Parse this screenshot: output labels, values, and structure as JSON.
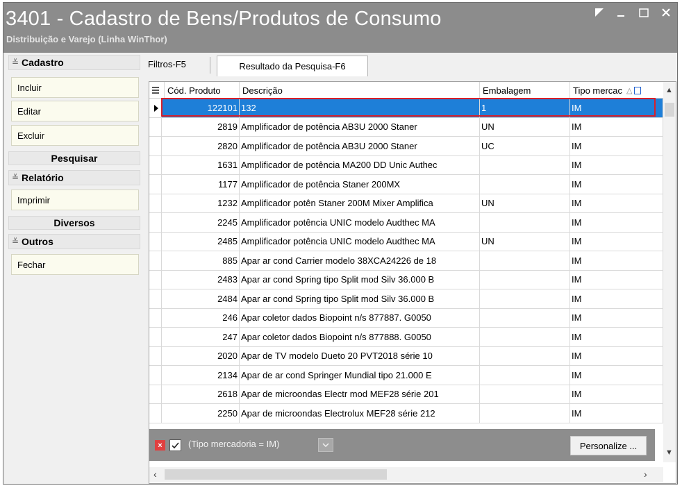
{
  "window": {
    "title": "3401 - Cadastro de Bens/Produtos de Consumo",
    "subtitle": "Distribuição e Varejo (Linha WinThor)"
  },
  "sidebar": {
    "sections": {
      "cadastro": "Cadastro",
      "pesquisar": "Pesquisar",
      "relatorio": "Relatório",
      "diversos": "Diversos",
      "outros": "Outros"
    },
    "buttons": {
      "incluir": "Incluir",
      "editar": "Editar",
      "excluir": "Excluir",
      "imprimir": "Imprimir",
      "fechar": "Fechar"
    }
  },
  "tabs": {
    "filtros": "Filtros-F5",
    "resultado": "Resultado da Pesquisa-F6"
  },
  "grid": {
    "columns": {
      "cod": "Cód. Produto",
      "desc": "Descrição",
      "emb": "Embalagem",
      "tipo": "Tipo mercac"
    },
    "rows": [
      {
        "cod": "122101",
        "desc": "132",
        "emb": "1",
        "tipo": "IM"
      },
      {
        "cod": "2819",
        "desc": "Amplificador de potência AB3U 2000 Staner",
        "emb": "UN",
        "tipo": "IM"
      },
      {
        "cod": "2820",
        "desc": "Amplificador de potência AB3U 2000 Staner",
        "emb": "UC",
        "tipo": "IM"
      },
      {
        "cod": "1631",
        "desc": "Amplificador de potência MA200 DD Unic Authec",
        "emb": "",
        "tipo": "IM"
      },
      {
        "cod": "1177",
        "desc": "Amplificador de potência Staner 200MX",
        "emb": "",
        "tipo": "IM"
      },
      {
        "cod": "1232",
        "desc": "Amplificador potên Staner 200M Mixer Amplifica",
        "emb": "UN",
        "tipo": "IM"
      },
      {
        "cod": "2245",
        "desc": "Amplificador potência UNIC modelo Audthec MA",
        "emb": "",
        "tipo": "IM"
      },
      {
        "cod": "2485",
        "desc": "Amplificador potência UNIC modelo Audthec MA",
        "emb": "UN",
        "tipo": "IM"
      },
      {
        "cod": "885",
        "desc": "Apar ar cond Carrier modelo 38XCA24226 de 18",
        "emb": "",
        "tipo": "IM"
      },
      {
        "cod": "2483",
        "desc": "Apar ar cond Spring tipo Split mod Silv 36.000 B",
        "emb": "",
        "tipo": "IM"
      },
      {
        "cod": "2484",
        "desc": "Apar ar cond Spring tipo Split mod Silv 36.000 B",
        "emb": "",
        "tipo": "IM"
      },
      {
        "cod": "246",
        "desc": "Apar coletor dados Biopoint n/s 877887. G0050",
        "emb": "",
        "tipo": "IM"
      },
      {
        "cod": "247",
        "desc": "Apar coletor dados Biopoint n/s 877888. G0050",
        "emb": "",
        "tipo": "IM"
      },
      {
        "cod": "2020",
        "desc": "Apar de TV  modelo Dueto 20 PVT2018 série 10",
        "emb": "",
        "tipo": "IM"
      },
      {
        "cod": "2134",
        "desc": "Apar de ar cond Springer Mundial tipo  21.000 E",
        "emb": "",
        "tipo": "IM"
      },
      {
        "cod": "2618",
        "desc": "Apar de microondas Electr mod MEF28 série 201",
        "emb": "",
        "tipo": "IM"
      },
      {
        "cod": "2250",
        "desc": "Apar de microondas Electrolux MEF28 série 212",
        "emb": "",
        "tipo": "IM"
      }
    ]
  },
  "filter": {
    "text": "(Tipo mercadoria = IM)",
    "customize": "Personalize ..."
  }
}
